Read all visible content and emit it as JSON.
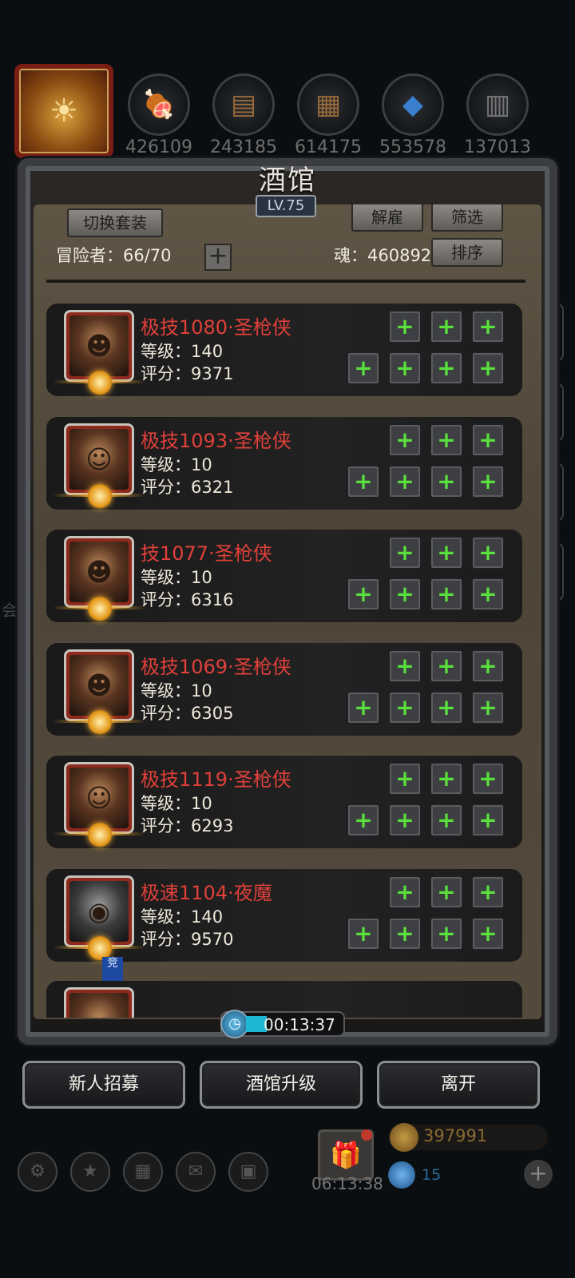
{
  "resources": [
    {
      "icon": "meat-icon",
      "value": "426109"
    },
    {
      "icon": "wood-icon",
      "value": "243185"
    },
    {
      "icon": "iron-icon",
      "value": "614175"
    },
    {
      "icon": "crystal-icon",
      "value": "553578"
    },
    {
      "icon": "stone-icon",
      "value": "137013"
    }
  ],
  "panel": {
    "title": "酒馆",
    "level": "LV.75",
    "switch_outfit": "切换套装",
    "dismiss": "解雇",
    "filter": "筛选",
    "sort": "排序",
    "adventurers_label": "冒险者：66/70",
    "soul_label": "魂：460892",
    "add_symbol": "+"
  },
  "heroes": [
    {
      "name": "极技1080·圣枪侠",
      "level": "等级：140",
      "score": "评分：9371"
    },
    {
      "name": "极技1093·圣枪侠",
      "level": "等级：10",
      "score": "评分：6321"
    },
    {
      "name": "技1077·圣枪侠",
      "level": "等级：10",
      "score": "评分：6316"
    },
    {
      "name": "极技1069·圣枪侠",
      "level": "等级：10",
      "score": "评分：6305"
    },
    {
      "name": "极技1119·圣枪侠",
      "level": "等级：10",
      "score": "评分：6293"
    },
    {
      "name": "极速1104·夜魔",
      "level": "等级：140",
      "score": "评分：9570"
    }
  ],
  "tag_badge": "竞",
  "timer": {
    "value": "00:13:37"
  },
  "buttons": {
    "recruit": "新人招募",
    "upgrade": "酒馆升级",
    "leave": "离开"
  },
  "footer": {
    "gift_timer": "06:13:38",
    "gold": "397991",
    "gems": "15",
    "left_edge_text": "会"
  }
}
